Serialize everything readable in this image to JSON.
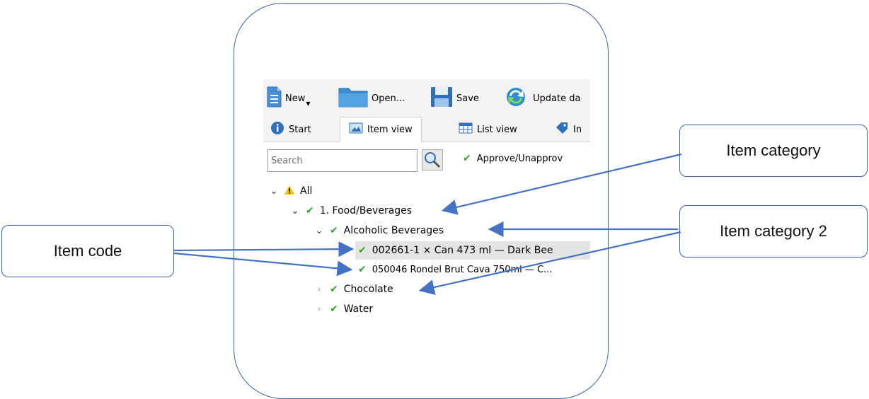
{
  "toolbar": {
    "new_label": "New",
    "open_label": "Open...",
    "save_label": "Save",
    "update_label": "Update da"
  },
  "tabs": [
    {
      "label": "Start"
    },
    {
      "label": "Item view"
    },
    {
      "label": "List view"
    },
    {
      "label": "In"
    }
  ],
  "search": {
    "placeholder": "Search"
  },
  "approve_label": "Approve/Unapprov",
  "tree": {
    "root": "All",
    "category": "1. Food/Beverages",
    "subcategory": "Alcoholic Beverages",
    "item1": "002661-1 × Can 473 ml — Dark Bee",
    "item2": "050046 Rondel Brut Cava 750ml — C...",
    "chocolate": "Chocolate",
    "water": "Water"
  },
  "callouts": {
    "item_category": "Item category",
    "item_category_2": "Item category 2",
    "item_code": "Item code"
  },
  "colors": {
    "callout_border": "#3e63a8",
    "arrow": "#4472c4",
    "check_green": "#2fa52f",
    "warning_yellow": "#f2c200"
  }
}
